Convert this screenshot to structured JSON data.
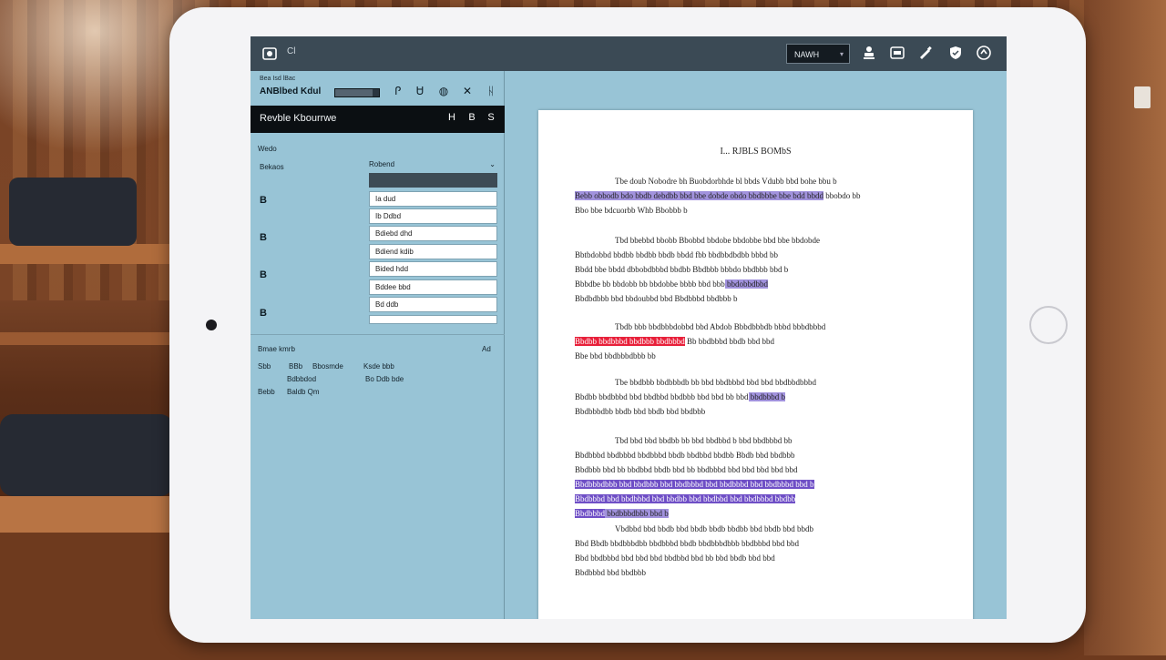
{
  "topbar": {
    "app_icon": "app-icon",
    "tiny_text": "Cl",
    "zoom_value": "NAWH",
    "buttons": [
      "stamp-icon",
      "redact-icon",
      "pen-icon",
      "shield-icon",
      "share-icon"
    ]
  },
  "sidebar": {
    "small_text": "Bea Isd lBac",
    "doc_label": "ANBlbed Kdul",
    "progress": 0.85,
    "tools": [
      "text-tool-icon",
      "highlight-tool-icon",
      "link-tool-icon",
      "cross-tool-icon",
      "strike-tool-icon"
    ],
    "panel_title": "Revble Kbourrwe",
    "panel_actions": [
      "H",
      "B",
      "S"
    ],
    "section_label": "Wedo",
    "row_label": "Bekaos",
    "list_header": "Robend",
    "numbered_icons": [
      "B",
      "B",
      "B",
      "B"
    ],
    "list_items": [
      "Ia dud",
      "Ib Ddbd",
      "Bdiebd dhd",
      "Bdiend kdib",
      "Bided hdd",
      "Bddee bbd",
      "Bd ddb"
    ],
    "notes_title": "Bmae kmrb",
    "notes_action": "Ad",
    "notes_lines": [
      [
        "Sbb",
        "BBb",
        "Bbosmde",
        "Ksde bbb"
      ],
      [
        "",
        "Bdbbdod",
        "Bo Ddb bde"
      ],
      [
        "Bebb",
        "Baldb Qm",
        ""
      ]
    ]
  },
  "document": {
    "title": "I... RJBLS BOMbS",
    "paragraphs": [
      {
        "lines": [
          {
            "segs": [
              {
                "t": "Tbe doub Nobodre bh Buobdorbhde bl bbds Vdubb bbd bohe bbu b"
              }
            ]
          },
          {
            "segs": [
              {
                "t": "Bebb obbodb bdo bbdb debdbb bbd bbe dobde obdo bbdbbbe bbe bdd bbdd",
                "h": "purple"
              },
              {
                "t": " bbobdo bb"
              }
            ]
          },
          {
            "segs": [
              {
                "t": "Bbo bbe bdcuorbb Whb Bbobbb b"
              }
            ]
          }
        ]
      },
      {
        "lines": [
          {
            "segs": [
              {
                "t": "Tbd bbebbd bbobb Bbobbd bbdobe bbdobbe bbd bbe bbdobde"
              }
            ]
          },
          {
            "segs": [
              {
                "t": "Bbtbdobbd bbdbb bbdbb bbdb bbdd fbb bbdbbdbdbb bbbd bb"
              }
            ]
          },
          {
            "segs": [
              {
                "t": "Bbdd bbe bbdd dbbobdbbbd bbdbb Bbdbbb bbbdo bbdbbb bbd b"
              }
            ]
          },
          {
            "segs": [
              {
                "t": "Bbbdbe bb bbdobb bb bbdobbe bbbb bbd bbb"
              },
              {
                "t": " bbdobbdbbd",
                "h": "purple"
              }
            ]
          },
          {
            "segs": [
              {
                "t": "Bbdbdbbb bbd bbdoubbd bbd Bbdbbbd bbdbbb b"
              }
            ]
          }
        ]
      },
      {
        "lines": [
          {
            "segs": [
              {
                "t": "Tbdb bbb bbdbbbdobbd bbd Abdob Bbbdbbbdb bbbd bbbdbbbd"
              }
            ]
          },
          {
            "segs": [
              {
                "t": "Bbdbb bbdbbbd bbdbbb bbdbbbd",
                "h": "red"
              },
              {
                "t": " Bb bbdbbbd bbdb bbd bbd"
              }
            ]
          },
          {
            "segs": [
              {
                "t": "Bbe bbd bbdbbbdbbb bb"
              }
            ]
          }
        ]
      },
      {
        "lines": [
          {
            "segs": [
              {
                "t": "Tbe bbdbbb bbdbbbdb bb bbd bbdbbbd bbd bbd bbdbbdbbbd"
              }
            ]
          },
          {
            "segs": [
              {
                "t": "Bbdbb bbdbbbd bbd bbdbbd bbdbbb bbd bbd bb bbd"
              },
              {
                "t": " bbdbbbd b",
                "h": "purple"
              }
            ]
          },
          {
            "segs": [
              {
                "t": "Bbdbbbdbb bbdb bbd bbdb bbd bbdbbb"
              }
            ]
          }
        ]
      },
      {
        "lines": [
          {
            "segs": [
              {
                "t": "Tbd bbd bbd bbdbb bb bbd bbdbbd b bbd bbdbbbd bb"
              }
            ]
          },
          {
            "segs": [
              {
                "t": "Bbdbbbd bbdbbbd bbdbbbd bbdb bbdbbd bbdbb Bbdb bbd bbdbbb"
              }
            ]
          },
          {
            "segs": [
              {
                "t": "Bbdbbb bbd bb bbdbbd bbdb bbd bb bbdbbbd bbd bbd bbd bbd bbd"
              }
            ]
          },
          {
            "segs": [
              {
                "t": "Bbdbbbdbbb bbd bbdbbb bbd bbdbbbd bbd bbdbbbd bbd bbdbbbd bbd b",
                "h": "violet"
              }
            ]
          },
          {
            "segs": [
              {
                "t": "Bbdbbbd bbd bbdbbbd bbd bbdbb bbd bbdbbd bbd bbdbbbd bbdbb",
                "h": "violet"
              }
            ]
          },
          {
            "segs": [
              {
                "t": "Bbdbbbd",
                "h": "violet"
              },
              {
                "t": " bbdbbbdbbb bbd b",
                "h": "purple"
              }
            ]
          }
        ]
      },
      {
        "lines": [
          {
            "segs": [
              {
                "t": "Vbdbbd bbd bbdb bbd bbdb bbdb bbdbb bbd bbdb bbd bbdb"
              }
            ]
          },
          {
            "segs": [
              {
                "t": "Bbd Bbdb bbdbbbdbb bbdbbbd bbdb bbdbbbdbbb bbdbbbd bbd bbd"
              }
            ]
          },
          {
            "segs": [
              {
                "t": "Bbd bbdbbbd bbd bbd bbd bbdbbd bbd bb bbd bbdb bbd bbd"
              }
            ]
          },
          {
            "segs": [
              {
                "t": "Bbdbbbd bbd bbdbbb"
              }
            ]
          }
        ]
      }
    ]
  }
}
